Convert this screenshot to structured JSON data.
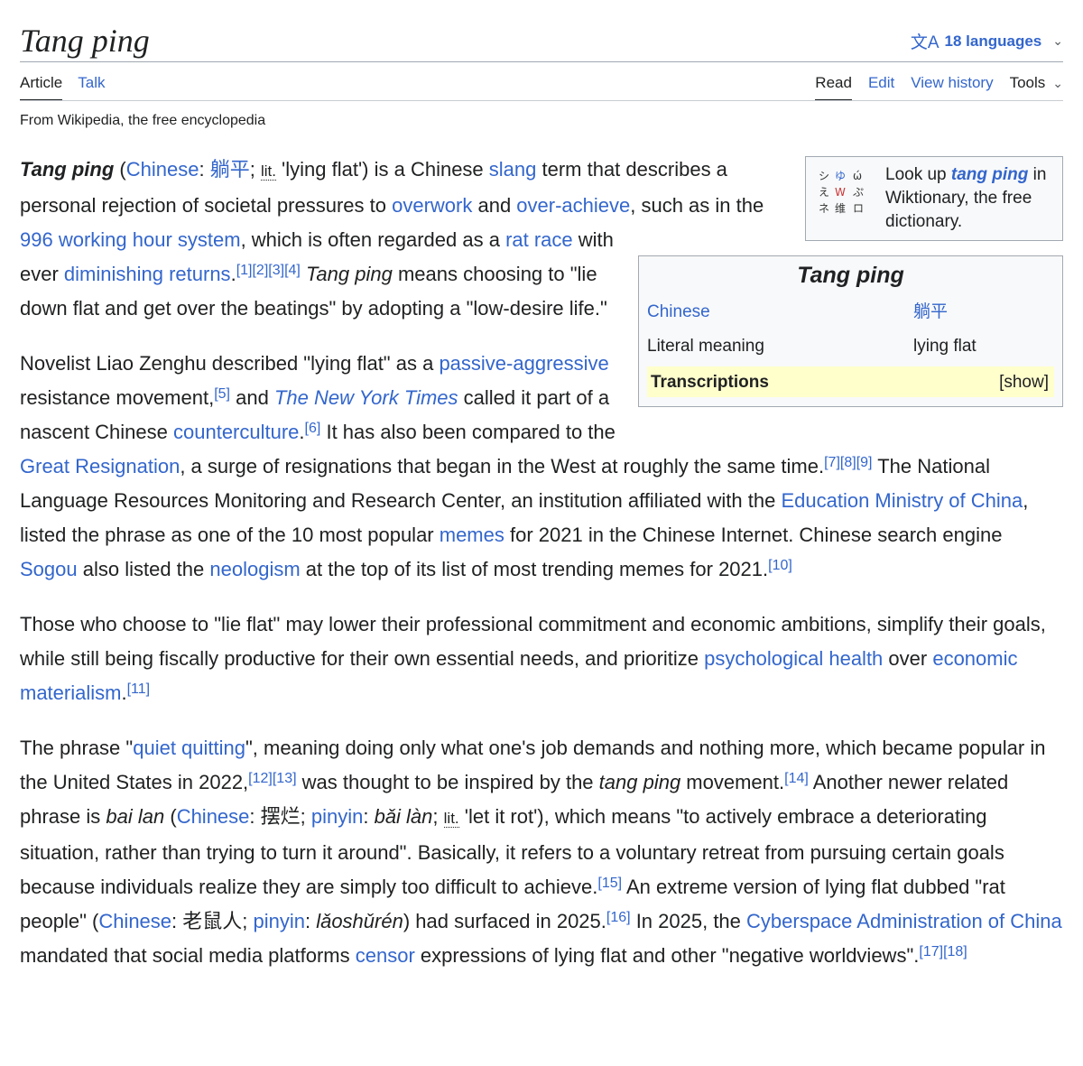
{
  "page": {
    "title": "Tang ping",
    "languages": "18 languages",
    "translate_glyph": "文A",
    "tagline": "From Wikipedia, the free encyclopedia"
  },
  "tabs": {
    "article": "Article",
    "talk": "Talk",
    "read": "Read",
    "edit": "Edit",
    "view_history": "View history",
    "tools": "Tools"
  },
  "wiktionary": {
    "look_up": "Look up",
    "term": "tang ping",
    "rest": "in Wiktionary, the free dictionary."
  },
  "infobox": {
    "title": "Tang ping",
    "row1_label": "Chinese",
    "row1_value": "躺平",
    "row2_label": "Literal meaning",
    "row2_value": "lying flat",
    "transcriptions": "Transcriptions",
    "show": "[show]"
  },
  "colors": {
    "link": "#3366cc",
    "text": "#202122",
    "highlight": "#ffffcc"
  },
  "icons": [
    "translate-icon",
    "chevron-down-icon",
    "wiktionary-logo"
  ]
}
